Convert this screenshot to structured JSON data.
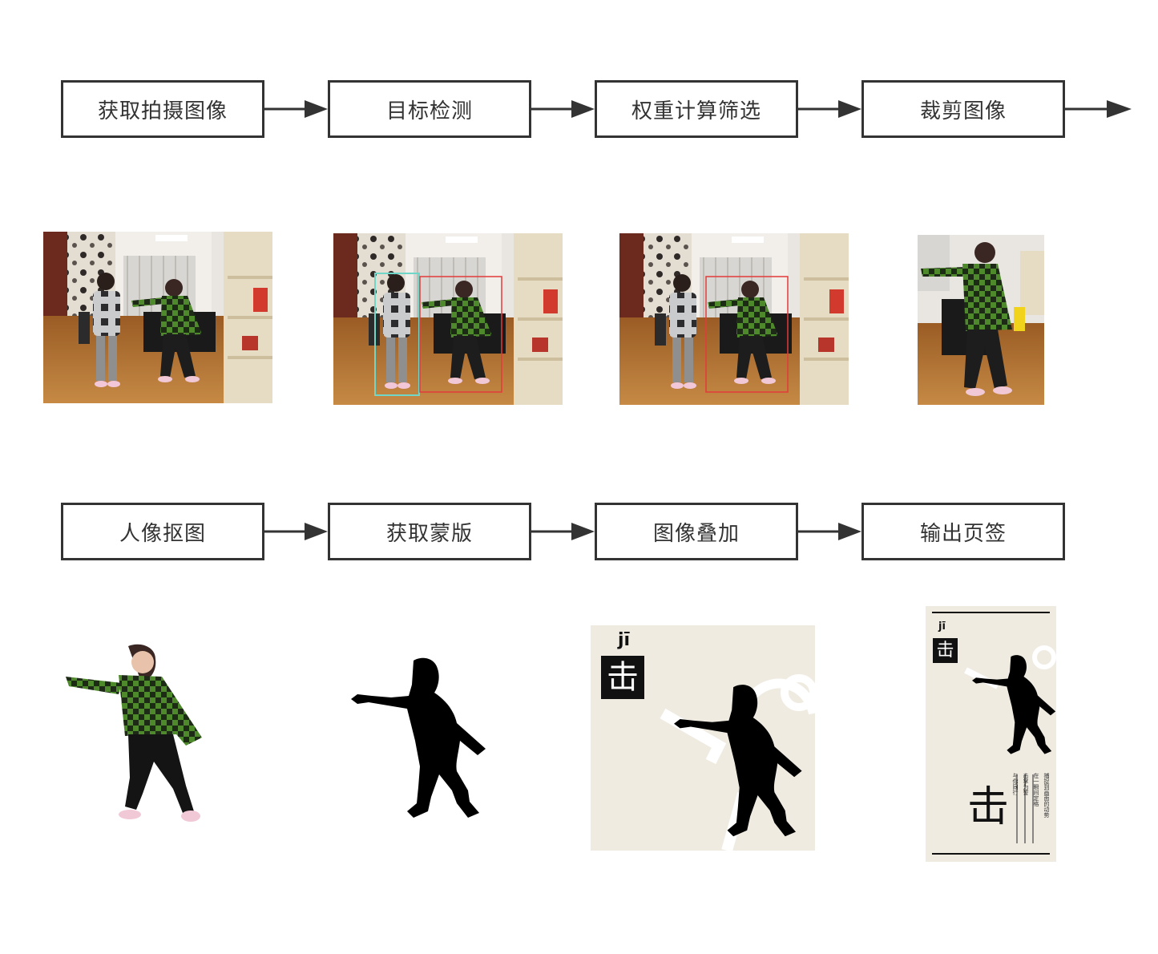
{
  "row1": {
    "steps": [
      "获取拍摄图像",
      "目标检测",
      "权重计算筛选",
      "裁剪图像"
    ]
  },
  "row2": {
    "steps": [
      "人像抠图",
      "获取蒙版",
      "图像叠加",
      "输出页签"
    ]
  },
  "poster": {
    "pinyin": "jī",
    "char": "击",
    "title_char": "击",
    "vertical_text": [
      "捕捉到画面的动势",
      "在一瞬间定格",
      "击掌为誓",
      "与你同行"
    ]
  },
  "colors": {
    "box_border": "#333333",
    "sweater_green": "#4e8a2c",
    "detect_red": "#e23b3b",
    "detect_cyan": "#6fd6c8",
    "paper": "#efebe1",
    "wood_floor": "#b5712f"
  },
  "detections": [
    {
      "target": "person-left",
      "color": "cyan"
    },
    {
      "target": "person-right",
      "color": "red"
    }
  ]
}
